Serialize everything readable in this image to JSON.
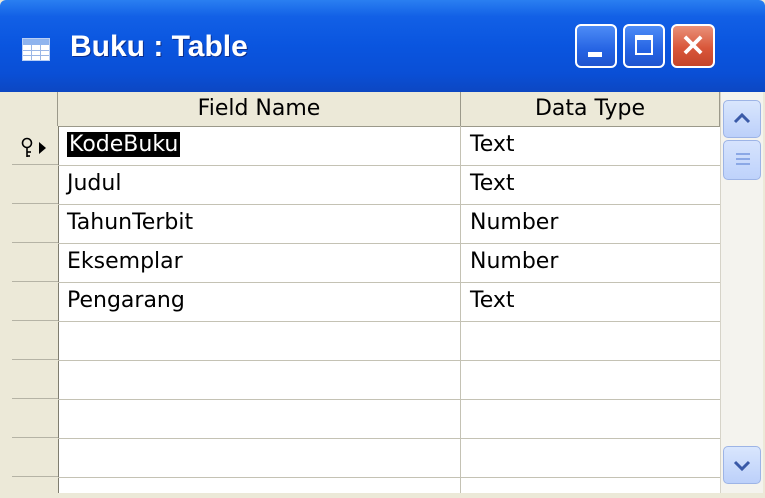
{
  "window": {
    "title": "Buku : Table",
    "icon": "table-icon",
    "controls": {
      "minimize": "minimize-icon",
      "maximize": "maximize-icon",
      "close_glyph": "×"
    }
  },
  "grid": {
    "columns": [
      "Field Name",
      "Data Type"
    ],
    "rows": [
      {
        "field_name": "KodeBuku",
        "data_type": "Text",
        "primary_key": true,
        "current": true
      },
      {
        "field_name": "Judul",
        "data_type": "Text"
      },
      {
        "field_name": "TahunTerbit",
        "data_type": "Number"
      },
      {
        "field_name": "Eksemplar",
        "data_type": "Number"
      },
      {
        "field_name": "Pengarang",
        "data_type": "Text"
      },
      {
        "field_name": "",
        "data_type": ""
      },
      {
        "field_name": "",
        "data_type": ""
      },
      {
        "field_name": "",
        "data_type": ""
      },
      {
        "field_name": "",
        "data_type": ""
      }
    ],
    "row_indicator_icons": [
      "key-icon",
      "current-row-arrow-icon"
    ]
  },
  "colors": {
    "titlebar": "#0a55df",
    "close_button": "#d9573a",
    "selection": "#000000",
    "chrome": "#ece9d8"
  }
}
